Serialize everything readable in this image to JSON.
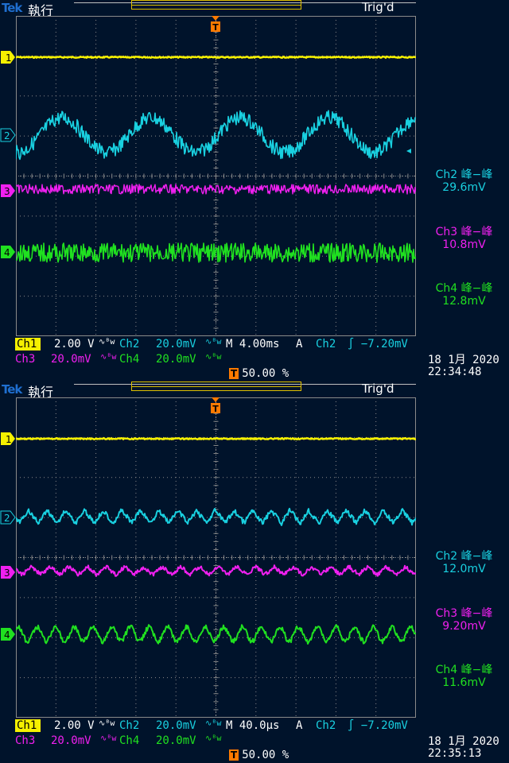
{
  "screens": [
    {
      "brand": "Tek",
      "run_state": "執行",
      "trigger_status": "Trig'd",
      "trigger_marker": "T",
      "ch1": {
        "label": "Ch1",
        "scale": "2.00 V",
        "coupling": "∿ᴮw"
      },
      "ch2": {
        "label": "Ch2",
        "scale": "20.0mV",
        "coupling": "∿ᴮw"
      },
      "ch3": {
        "label": "Ch3",
        "scale": "20.0mV",
        "coupling": "∿ᴮw"
      },
      "ch4": {
        "label": "Ch4",
        "scale": "20.0mV",
        "coupling": "∿ᴮw"
      },
      "timebase": "M 4.00ms",
      "trigger_mode": "A",
      "trigger_source": "Ch2",
      "trigger_level": "∫ −7.20mV",
      "trigger_position": "50.00 %",
      "date": "18 1月  2020",
      "time": "22:34:48",
      "measurements": [
        {
          "channel": "Ch2 峰−峰",
          "value": "29.6mV"
        },
        {
          "channel": "Ch3 峰−峰",
          "value": "10.8mV"
        },
        {
          "channel": "Ch4 峰−峰",
          "value": "12.8mV"
        }
      ],
      "channel_markers": [
        "1",
        "2",
        "3",
        "4"
      ]
    },
    {
      "brand": "Tek",
      "run_state": "執行",
      "trigger_status": "Trig'd",
      "trigger_marker": "T",
      "ch1": {
        "label": "Ch1",
        "scale": "2.00 V",
        "coupling": "∿ᴮw"
      },
      "ch2": {
        "label": "Ch2",
        "scale": "20.0mV",
        "coupling": "∿ᴮw"
      },
      "ch3": {
        "label": "Ch3",
        "scale": "20.0mV",
        "coupling": "∿ᴮw"
      },
      "ch4": {
        "label": "Ch4",
        "scale": "20.0mV",
        "coupling": "∿ᴮw"
      },
      "timebase": "M 40.0µs",
      "trigger_mode": "A",
      "trigger_source": "Ch2",
      "trigger_level": "∫ −7.20mV",
      "trigger_position": "50.00 %",
      "date": "18 1月  2020",
      "time": "22:35:13",
      "measurements": [
        {
          "channel": "Ch2 峰−峰",
          "value": "12.0mV"
        },
        {
          "channel": "Ch3 峰−峰",
          "value": "9.20mV"
        },
        {
          "channel": "Ch4 峰−峰",
          "value": "11.6mV"
        }
      ],
      "channel_markers": [
        "1",
        "2",
        "3",
        "4"
      ]
    }
  ],
  "colors": {
    "ch1": "#f5f000",
    "ch2": "#19d0e0",
    "ch3": "#f020f0",
    "ch4": "#20e020",
    "grid": "#8a8a8a",
    "trigger": "#ff7a00",
    "background": "#00132b"
  }
}
